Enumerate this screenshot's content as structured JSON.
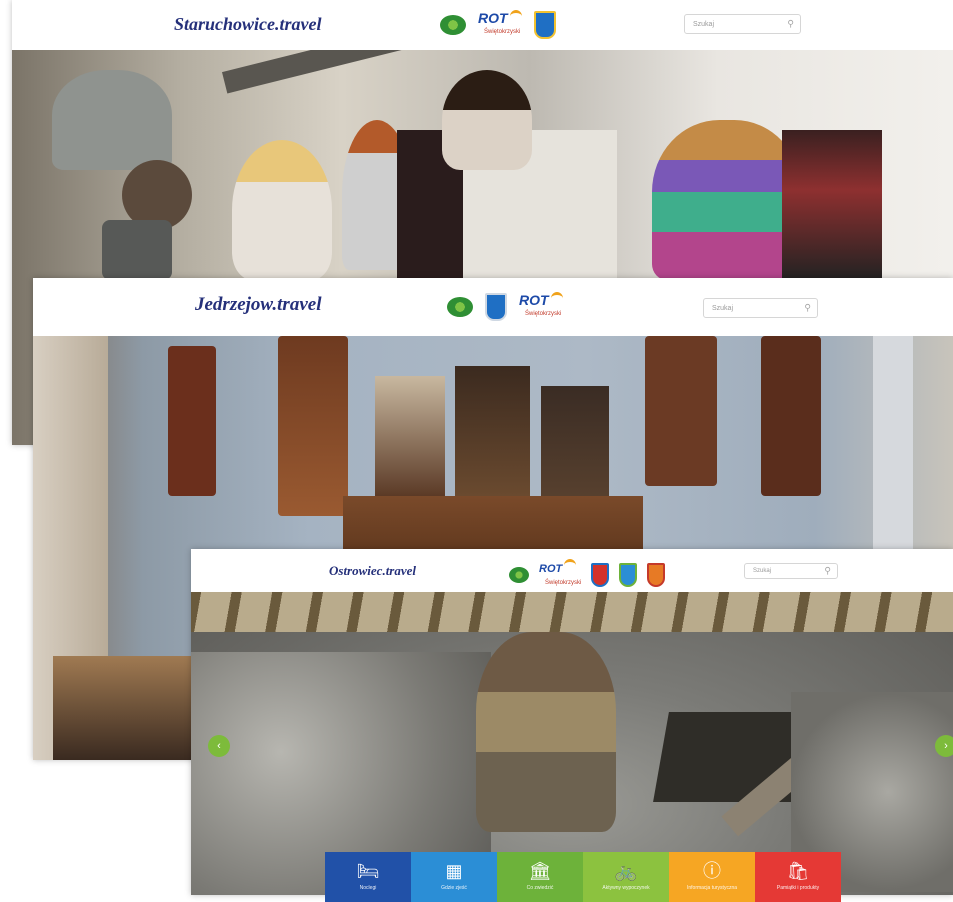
{
  "colors": {
    "brand": "#25307a",
    "green": "#7dbb3b",
    "tile_colors": [
      "#2151a8",
      "#2b8ed6",
      "#6db23a",
      "#8cc23f",
      "#f6a623",
      "#e53935"
    ]
  },
  "panels": [
    {
      "brand": "Staruchowice.travel",
      "search_placeholder": "Szukaj",
      "logos": [
        "eko-logo",
        "rot-logo",
        "coat-of-arms-blue"
      ]
    },
    {
      "brand": "Jedrzejow.travel",
      "search_placeholder": "Szukaj",
      "logos": [
        "eko-logo",
        "coat-of-arms-blue",
        "rot-logo"
      ]
    },
    {
      "brand": "Ostrowiec.travel",
      "search_placeholder": "Szukaj",
      "logos": [
        "eko-logo",
        "rot-logo",
        "coat-of-arms-red",
        "coat-of-arms-blue",
        "coat-of-arms-orange"
      ]
    }
  ],
  "rot_logo": {
    "text": "ROT",
    "sub": "Świętokrzyski"
  },
  "nav": {
    "prev_icon": "chevron-left-icon",
    "next_icon": "chevron-right-icon",
    "prev": "‹",
    "next": "›"
  },
  "tiles": [
    {
      "icon": "bed-icon",
      "glyph": "🛏",
      "label": "Noclegi"
    },
    {
      "icon": "map-icon",
      "glyph": "▦",
      "label": "Gdzie zjeść"
    },
    {
      "icon": "museum-icon",
      "glyph": "🏛",
      "label": "Co zwiedzić"
    },
    {
      "icon": "bike-icon",
      "glyph": "🚲",
      "label": "Aktywny wypoczynek"
    },
    {
      "icon": "info-icon",
      "glyph": "ⓘ",
      "label": "Informacja turystyczna"
    },
    {
      "icon": "bag-icon",
      "glyph": "🛍",
      "label": "Pamiątki i produkty"
    }
  ]
}
